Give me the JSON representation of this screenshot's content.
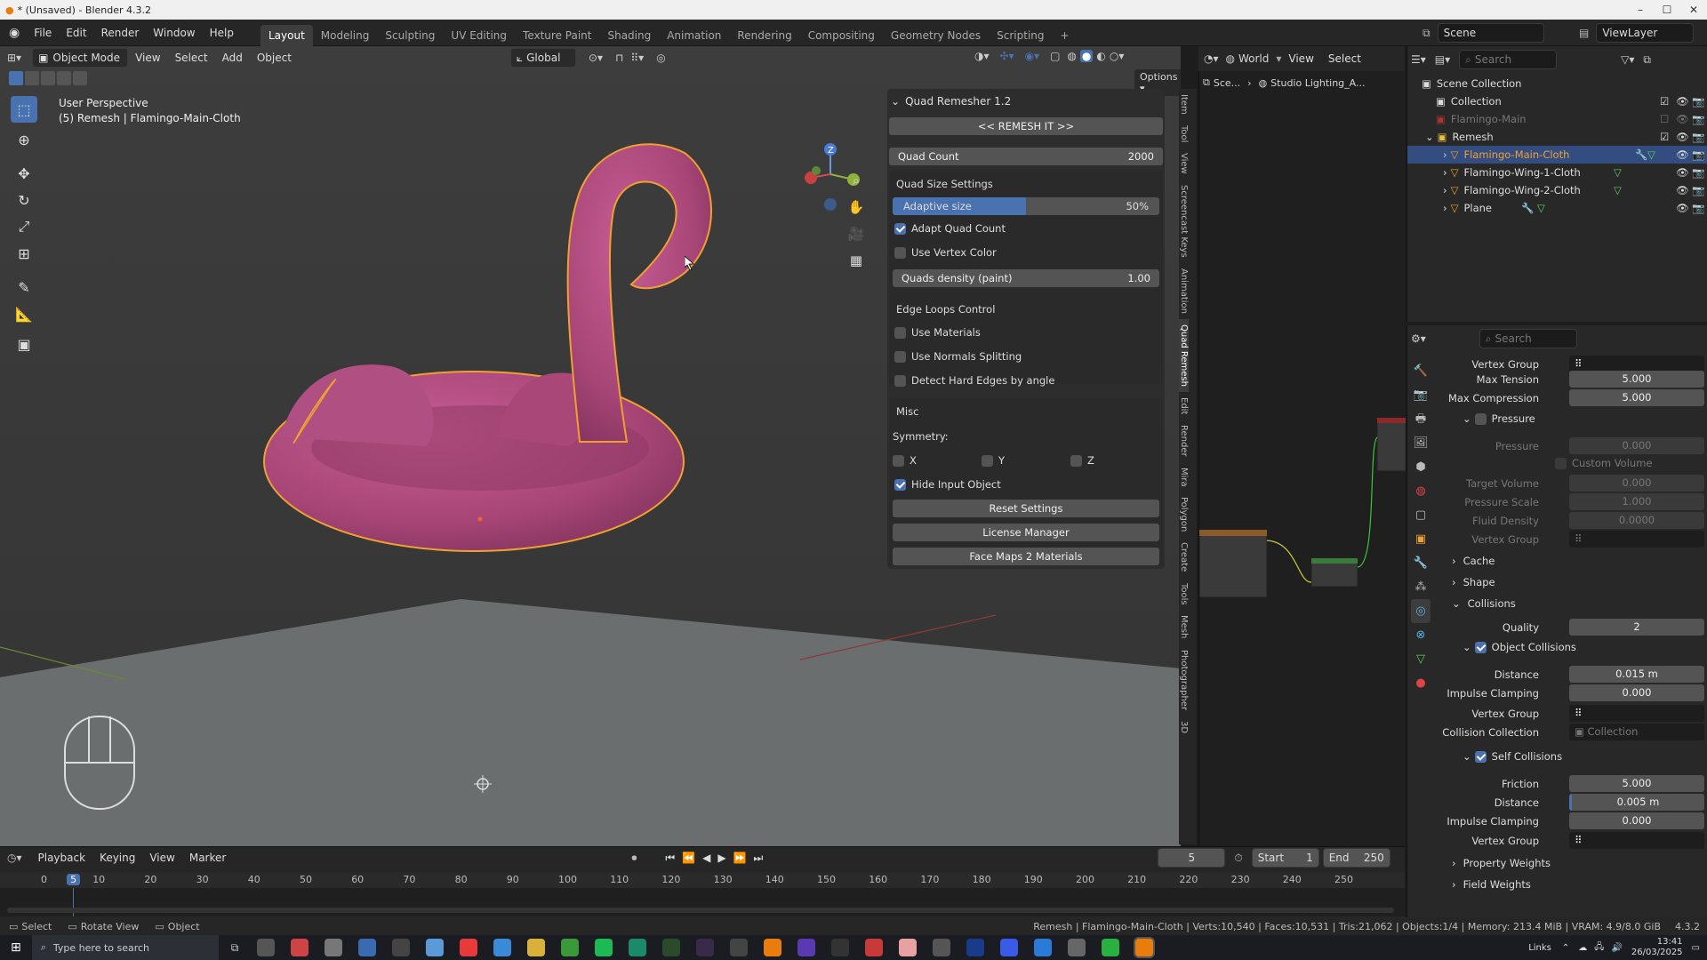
{
  "titlebar": {
    "title": "* (Unsaved) - Blender 4.3.2",
    "minimize": "–",
    "maximize": "☐",
    "close": "✕"
  },
  "menubar": {
    "menus": [
      "File",
      "Edit",
      "Render",
      "Window",
      "Help"
    ],
    "workspaces": [
      "Layout",
      "Modeling",
      "Sculpting",
      "UV Editing",
      "Texture Paint",
      "Shading",
      "Animation",
      "Rendering",
      "Compositing",
      "Geometry Nodes",
      "Scripting"
    ],
    "active_workspace": "Layout",
    "add_tab": "+",
    "scene": "Scene",
    "view_layer": "ViewLayer"
  },
  "viewport_header": {
    "mode": "Object Mode",
    "menus": [
      "View",
      "Select",
      "Add",
      "Object"
    ],
    "transform": "Global",
    "options": "Options"
  },
  "viewport": {
    "perspective": "User Perspective",
    "object_info": "(5) Remesh | Flamingo-Main-Cloth"
  },
  "quad_remesher": {
    "title": "Quad Remesher 1.2",
    "remesh_button": "<< REMESH IT >>",
    "quad_count_label": "Quad Count",
    "quad_count_value": "2000",
    "size_settings_title": "Quad Size Settings",
    "adaptive_label": "Adaptive size",
    "adaptive_value": "50%",
    "adaptive_fraction": 0.5,
    "adapt_quad_count": "Adapt Quad Count",
    "adapt_quad_count_checked": true,
    "use_vertex_color": "Use Vertex Color",
    "use_vertex_color_checked": false,
    "density_label": "Quads density (paint)",
    "density_value": "1.00",
    "edge_loops_title": "Edge Loops Control",
    "use_materials": "Use Materials",
    "use_normals": "Use Normals Splitting",
    "detect_hard": "Detect Hard Edges by angle",
    "misc_title": "Misc",
    "symmetry_label": "Symmetry:",
    "sym_x": "X",
    "sym_y": "Y",
    "sym_z": "Z",
    "hide_input": "Hide Input Object",
    "hide_input_checked": true,
    "reset_settings": "Reset Settings",
    "license_manager": "License Manager",
    "face_maps": "Face Maps 2 Materials"
  },
  "sidebar_tabs": [
    "Item",
    "Tool",
    "View",
    "Screencast Keys",
    "Animation",
    "Quad Remesh",
    "Edit",
    "Render",
    "Mira",
    "Polygon",
    "Create",
    "Tools",
    "Mesh",
    "Photographer",
    "3D"
  ],
  "node_editor": {
    "header_menus": [
      "View",
      "Select"
    ],
    "world": "World",
    "breadcrumb_scene": "Sce...",
    "breadcrumb_world": "Studio Lighting_A..."
  },
  "outliner": {
    "search_placeholder": "Search",
    "rows": [
      {
        "label": "Scene Collection",
        "level": 0
      },
      {
        "label": "Collection",
        "level": 1
      },
      {
        "label": "Flamingo-Main",
        "level": 1
      },
      {
        "label": "Remesh",
        "level": 1
      },
      {
        "label": "Flamingo-Main-Cloth",
        "level": 2
      },
      {
        "label": "Flamingo-Wing-1-Cloth",
        "level": 2
      },
      {
        "label": "Flamingo-Wing-2-Cloth",
        "level": 2
      },
      {
        "label": "Plane",
        "level": 2
      }
    ]
  },
  "properties": {
    "search_placeholder": "Search",
    "vertex_group_label": "Vertex Group",
    "max_tension_label": "Max Tension",
    "max_tension": "5.000",
    "max_compression_label": "Max Compression",
    "max_compression": "5.000",
    "pressure_title": "Pressure",
    "pressure_label": "Pressure",
    "pressure": "0.000",
    "custom_volume": "Custom Volume",
    "target_volume_label": "Target Volume",
    "target_volume": "0.000",
    "pressure_scale_label": "Pressure Scale",
    "pressure_scale": "1.000",
    "fluid_density_label": "Fluid Density",
    "fluid_density": "0.0000",
    "vertex_group_label2": "Vertex Group",
    "cache": "Cache",
    "shape": "Shape",
    "collisions": "Collisions",
    "quality_label": "Quality",
    "quality": "2",
    "object_collisions": "Object Collisions",
    "distance_label": "Distance",
    "distance": "0.015 m",
    "impulse_label": "Impulse Clamping",
    "impulse": "0.000",
    "vertex_group_label3": "Vertex Group",
    "collision_collection_label": "Collision Collection",
    "collision_collection": "Collection",
    "self_collisions": "Self Collisions",
    "friction_label": "Friction",
    "friction": "5.000",
    "self_distance_label": "Distance",
    "self_distance": "0.005 m",
    "self_impulse_label": "Impulse Clamping",
    "self_impulse": "0.000",
    "vertex_group_label4": "Vertex Group",
    "property_weights": "Property Weights",
    "field_weights": "Field Weights"
  },
  "timeline": {
    "menus": [
      "Playback",
      "Keying",
      "View",
      "Marker"
    ],
    "current_frame": "5",
    "start_label": "Start",
    "start": "1",
    "end_label": "End",
    "end": "250",
    "ticks": [
      "0",
      "5",
      "10",
      "20",
      "30",
      "40",
      "50",
      "60",
      "70",
      "80",
      "90",
      "100",
      "110",
      "120",
      "130",
      "140",
      "150",
      "160",
      "170",
      "180",
      "190",
      "200",
      "210",
      "220",
      "230",
      "240",
      "250"
    ]
  },
  "statusbar": {
    "left": [
      "Select",
      "Rotate View",
      "Object"
    ],
    "right": "Remesh | Flamingo-Main-Cloth | Verts:10,540 | Faces:10,531 | Tris:21,062 | Objects:1/4 | Memory: 213.4 MiB | VRAM: 4.9/8.0 GiB",
    "version": "4.3.2"
  },
  "taskbar": {
    "search_placeholder": "Type here to search",
    "tray_text": "Links",
    "time": "13:41",
    "date": "26/03/2025"
  },
  "colors": {
    "accent": "#4a72b0",
    "flamingo": "#b44c82",
    "outline": "#f0a030",
    "selected_row": "#334d80"
  }
}
